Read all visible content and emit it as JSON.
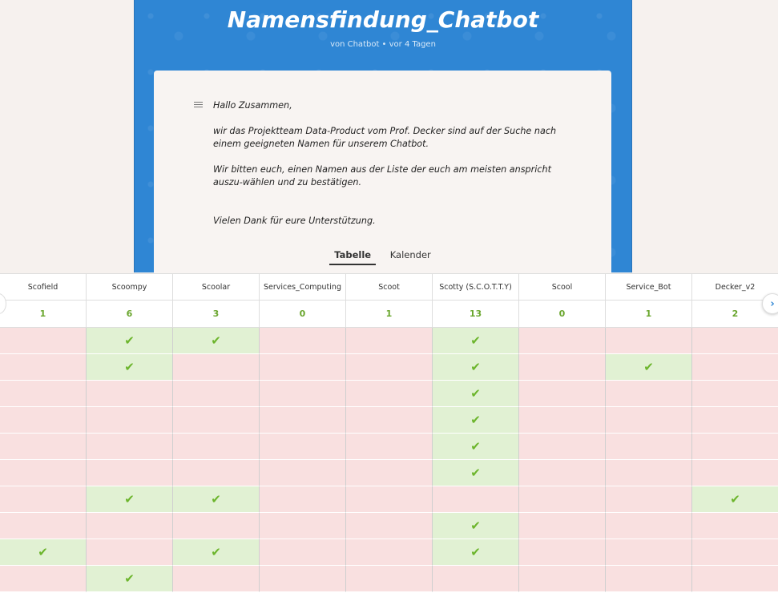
{
  "poll": {
    "title": "Namensfindung_Chatbot",
    "subtitle": "von Chatbot • vor 4 Tagen",
    "description": [
      "Hallo Zusammen,",
      "wir das Projektteam Data-Product vom Prof. Decker sind auf der Suche nach einem geeigneten Namen für unserem Chatbot.",
      "Wir bitten euch, einen Namen aus der Liste der euch am meisten anspricht auszu-wählen und zu bestätigen.",
      "Vielen Dank für eure Unterstützung."
    ]
  },
  "tabs": [
    "Tabelle",
    "Kalender"
  ],
  "active_tab": "Tabelle",
  "icons": {
    "description": "notes-icon",
    "vote_yes": "check-icon",
    "scroll_right": "chevron-right-icon"
  },
  "colors": {
    "banner": "#2f86d4",
    "yes_cell": "#e1f1d3",
    "no_cell": "#f9e0e0",
    "count_text": "#6aa62e",
    "check": "#6cb52c"
  },
  "table": {
    "options": [
      "Scofield",
      "Scoompy",
      "Scoolar",
      "Services_Computing",
      "Scoot",
      "Scotty (S.C.O.T.T.Y)",
      "Scool",
      "Service_Bot",
      "Decker_v2"
    ],
    "counts": [
      "1",
      "6",
      "3",
      "0",
      "1",
      "13",
      "0",
      "1",
      "2"
    ],
    "votes": [
      [
        0,
        1,
        1,
        0,
        0,
        1,
        0,
        0,
        0
      ],
      [
        0,
        1,
        0,
        0,
        0,
        1,
        0,
        1,
        0
      ],
      [
        0,
        0,
        0,
        0,
        0,
        1,
        0,
        0,
        0
      ],
      [
        0,
        0,
        0,
        0,
        0,
        1,
        0,
        0,
        0
      ],
      [
        0,
        0,
        0,
        0,
        0,
        1,
        0,
        0,
        0
      ],
      [
        0,
        0,
        0,
        0,
        0,
        1,
        0,
        0,
        0
      ],
      [
        0,
        1,
        1,
        0,
        0,
        0,
        0,
        0,
        1
      ],
      [
        0,
        0,
        0,
        0,
        0,
        1,
        0,
        0,
        0
      ],
      [
        1,
        0,
        1,
        0,
        0,
        1,
        0,
        0,
        0
      ],
      [
        0,
        1,
        0,
        0,
        0,
        0,
        0,
        0,
        0
      ]
    ],
    "check_glyph": "✔"
  }
}
